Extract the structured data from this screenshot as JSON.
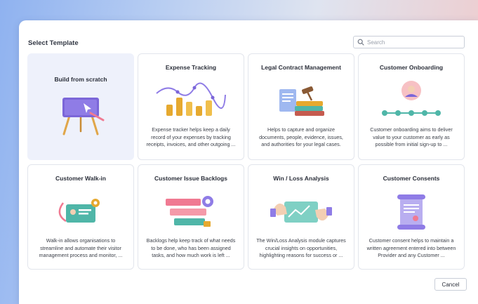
{
  "modal": {
    "title": "Select Template",
    "search": {
      "placeholder": "Search",
      "value": ""
    },
    "cancel_label": "Cancel"
  },
  "templates": [
    {
      "title": "Build from scratch",
      "description": ""
    },
    {
      "title": "Expense Tracking",
      "description": "Expense tracker helps keep a daily record of your expenses by tracking receipts, invoices, and other outgoing ..."
    },
    {
      "title": "Legal Contract Management",
      "description": "Helps to capture and organize documents, people, evidence, issues, and authorities for your legal cases."
    },
    {
      "title": "Customer Onboarding",
      "description": "Customer onboarding aims to deliver value to your customer as early as possible from initial sign-up to ..."
    },
    {
      "title": "Customer Walk-in",
      "description": "Walk-in allows organisations to streamline and automate their visitor management process and monitor, ..."
    },
    {
      "title": "Customer Issue Backlogs",
      "description": "Backlogs help keep track of what needs to be done, who has been assigned tasks, and how much work is left ..."
    },
    {
      "title": "Win / Loss Analysis",
      "description": "The Win/Loss Analysis module captures crucial insights on opportunities, highlighting reasons for success or ..."
    },
    {
      "title": "Customer Consents",
      "description": "Customer consent helps to maintain a written agreement entered into between Provider and any Customer ..."
    }
  ],
  "colors": {
    "accent_purple": "#7b66d8",
    "accent_teal": "#4fb6a8",
    "accent_gold": "#e6a92f",
    "accent_pink": "#f07a92"
  }
}
